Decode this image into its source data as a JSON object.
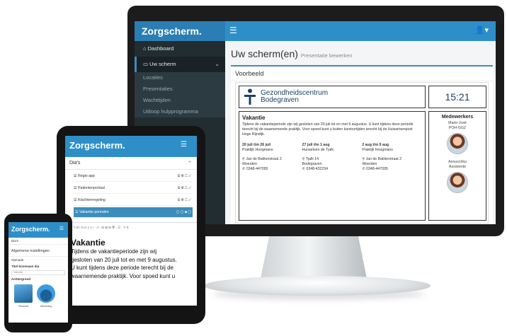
{
  "monitor": {
    "brand": "Zorgscherm.",
    "sidebar": {
      "dashboard": "Dashboard",
      "uw_scherm": "Uw scherm",
      "subitems": [
        "Locaties",
        "Presentaties",
        "Wachttijden",
        "Uitloop hulpprogramma"
      ]
    },
    "page_title": "Uw scherm(en)",
    "page_subtitle": "Presentatie bewerken",
    "box_title": "Voorbeeld",
    "preview": {
      "org_line1": "Gezondheidscentrum",
      "org_line2": "Bodegraven",
      "clock": "15:21",
      "title": "Vakantie",
      "body": "Tijdens de vakantieperiode zijn wij gesloten van 20 juli tot en met 9 augustus. U kunt tijdens deze periode terecht bij de waarnemende praktijk. Voor spoed kunt u buiten kantoortijden terecht bij de Huisartsenpost Hoge Rijndijk.",
      "columns": [
        {
          "dates": "20 juli t/m 26 juli",
          "practice": "Praktijk Hoogmans",
          "street": "Jan de Bakkerstraat 2",
          "city": "Woerden",
          "phone": "0348-447095"
        },
        {
          "dates": "27 juli t/m 1 aug",
          "practice": "Huisartsen de Tjalk",
          "street": "Tjalk 14",
          "city": "Bodegraven",
          "phone": "0348-432234"
        },
        {
          "dates": "2 aug t/m 9 aug",
          "practice": "Praktijk Hoogmans",
          "street": "Jan de Bakkerstraat 2",
          "city": "Woerden",
          "phone": "0348-447095"
        }
      ],
      "staff_title": "Medewerkers",
      "staff": [
        {
          "name": "Marie-José",
          "role": "POH-GGZ"
        },
        {
          "name": "Anouschka",
          "role": "Assistente"
        }
      ]
    }
  },
  "tablet": {
    "brand": "Zorgscherm.",
    "section": "Dia's",
    "rows": [
      "Regio app",
      "Patientenportaal",
      "Klachtenregeling",
      "Vakantie perioden"
    ],
    "heading": "Vakantie",
    "lines": [
      "Tijdens de vakantieperiode zijn wij",
      "gesloten van 20 juli tot en met 9 augustus.",
      "U kunt tijdens deze periode terecht bij de",
      "waarnemende praktijk. Voor spoed kunt u"
    ]
  },
  "phone": {
    "brand": "Zorgscherm.",
    "crumb": "Dia's",
    "settings": "Algemene instellingen",
    "label1": "Opmaak",
    "label2": "Titel bovenaan dia",
    "field": "Vakantie",
    "label3": "Achtergrond",
    "captions": [
      "Tekstveld",
      "Afbeelding"
    ]
  }
}
